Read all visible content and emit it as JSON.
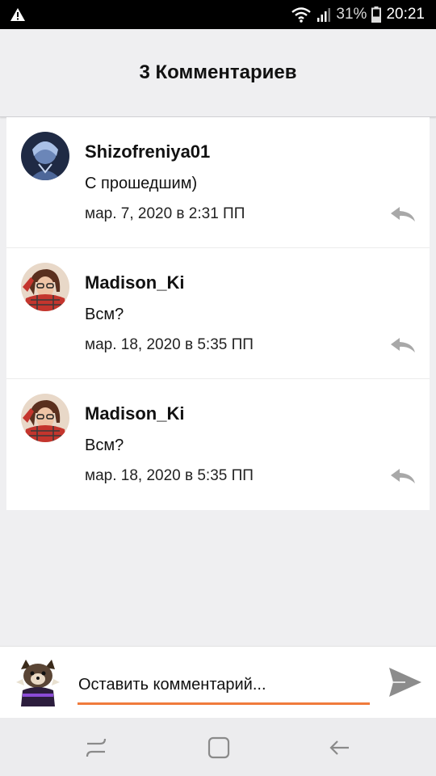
{
  "status_bar": {
    "battery_percent": "31%",
    "time": "20:21",
    "icons": [
      "warning-icon",
      "wifi-icon",
      "signal-icon",
      "battery-icon"
    ]
  },
  "header": {
    "title": "3 Комментариев"
  },
  "comments": [
    {
      "username": "Shizofreniya01",
      "text": "С прошедшим)",
      "date": "мар. 7, 2020 в 2:31 ПП"
    },
    {
      "username": "Madison_Ki",
      "text": "Всм?",
      "date": "мар. 18, 2020 в 5:35 ПП"
    },
    {
      "username": "Madison_Ki",
      "text": "Всм?",
      "date": "мар. 18, 2020 в 5:35 ПП"
    }
  ],
  "input": {
    "placeholder": "Оставить комментарий..."
  },
  "colors": {
    "accent": "#f07b3c",
    "background": "#efeff1",
    "icon_gray": "#9e9e9e"
  },
  "nav": {
    "icons": [
      "recent-apps-icon",
      "home-icon",
      "back-icon"
    ]
  }
}
